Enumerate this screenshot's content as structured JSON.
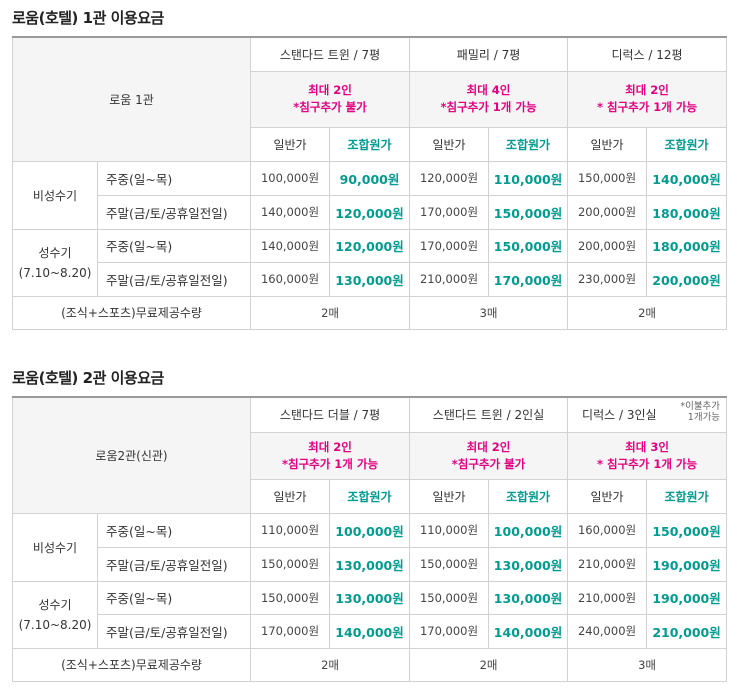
{
  "sections": [
    {
      "title": "로움(호텔) 1관 이용요금",
      "room_label": "로움 1관",
      "rooms": [
        {
          "name": "스탠다드 트윈 / 7평",
          "cap1": "최대 2인",
          "cap2": "*침구추가 불가",
          "note": ""
        },
        {
          "name": "패밀리 / 7평",
          "cap1": "최대 4인",
          "cap2": "*침구추가 1개 가능",
          "note": ""
        },
        {
          "name": "디럭스 / 12평",
          "cap1": "최대 2인",
          "cap2": "* 침구추가 1개 가능",
          "note": ""
        }
      ],
      "price_headers": {
        "normal": "일반가",
        "combo": "조합원가"
      },
      "seasons": [
        {
          "name_line1": "비성수기",
          "name_line2": "",
          "rows": [
            {
              "period": "주중(일~목)",
              "prices": [
                [
                  "100,000원",
                  "90,000원"
                ],
                [
                  "120,000원",
                  "110,000원"
                ],
                [
                  "150,000원",
                  "140,000원"
                ]
              ]
            },
            {
              "period": "주말(금/토/공휴일전일)",
              "prices": [
                [
                  "140,000원",
                  "120,000원"
                ],
                [
                  "170,000원",
                  "150,000원"
                ],
                [
                  "200,000원",
                  "180,000원"
                ]
              ]
            }
          ]
        },
        {
          "name_line1": "성수기",
          "name_line2": "(7.10~8.20)",
          "rows": [
            {
              "period": "주중(일~목)",
              "prices": [
                [
                  "140,000원",
                  "120,000원"
                ],
                [
                  "170,000원",
                  "150,000원"
                ],
                [
                  "200,000원",
                  "180,000원"
                ]
              ]
            },
            {
              "period": "주말(금/토/공휴일전일)",
              "prices": [
                [
                  "160,000원",
                  "130,000원"
                ],
                [
                  "210,000원",
                  "170,000원"
                ],
                [
                  "230,000원",
                  "200,000원"
                ]
              ]
            }
          ]
        }
      ],
      "free_label": "(조식+스포츠)무료제공수량",
      "free_counts": [
        "2매",
        "3매",
        "2매"
      ]
    },
    {
      "title": "로움(호텔) 2관 이용요금",
      "room_label": "로움2관(신관)",
      "rooms": [
        {
          "name": "스탠다드 더블 / 7평",
          "cap1": "최대 2인",
          "cap2": "*침구추가 1개 가능",
          "note": ""
        },
        {
          "name": "스탠다드 트윈 / 2인실",
          "cap1": "최대 2인",
          "cap2": "*침구추가 불가",
          "note": ""
        },
        {
          "name": "디럭스 / 3인실",
          "cap1": "최대 3인",
          "cap2": "* 침구추가 1개 가능",
          "note_line1": "*이불추가",
          "note_line2": "1개가능"
        }
      ],
      "price_headers": {
        "normal": "일반가",
        "combo": "조합원가"
      },
      "seasons": [
        {
          "name_line1": "비성수기",
          "name_line2": "",
          "rows": [
            {
              "period": "주중(일~목)",
              "prices": [
                [
                  "110,000원",
                  "100,000원"
                ],
                [
                  "110,000원",
                  "100,000원"
                ],
                [
                  "160,000원",
                  "150,000원"
                ]
              ]
            },
            {
              "period": "주말(금/토/공휴일전일)",
              "prices": [
                [
                  "150,000원",
                  "130,000원"
                ],
                [
                  "150,000원",
                  "130,000원"
                ],
                [
                  "210,000원",
                  "190,000원"
                ]
              ]
            }
          ]
        },
        {
          "name_line1": "성수기",
          "name_line2": "(7.10~8.20)",
          "rows": [
            {
              "period": "주중(일~목)",
              "prices": [
                [
                  "150,000원",
                  "130,000원"
                ],
                [
                  "150,000원",
                  "130,000원"
                ],
                [
                  "210,000원",
                  "190,000원"
                ]
              ]
            },
            {
              "period": "주말(금/토/공휴일전일)",
              "prices": [
                [
                  "170,000원",
                  "140,000원"
                ],
                [
                  "170,000원",
                  "140,000원"
                ],
                [
                  "240,000원",
                  "210,000원"
                ]
              ]
            }
          ]
        }
      ],
      "free_label": "(조식+스포츠)무료제공수량",
      "free_counts": [
        "2매",
        "2매",
        "3매"
      ]
    }
  ]
}
